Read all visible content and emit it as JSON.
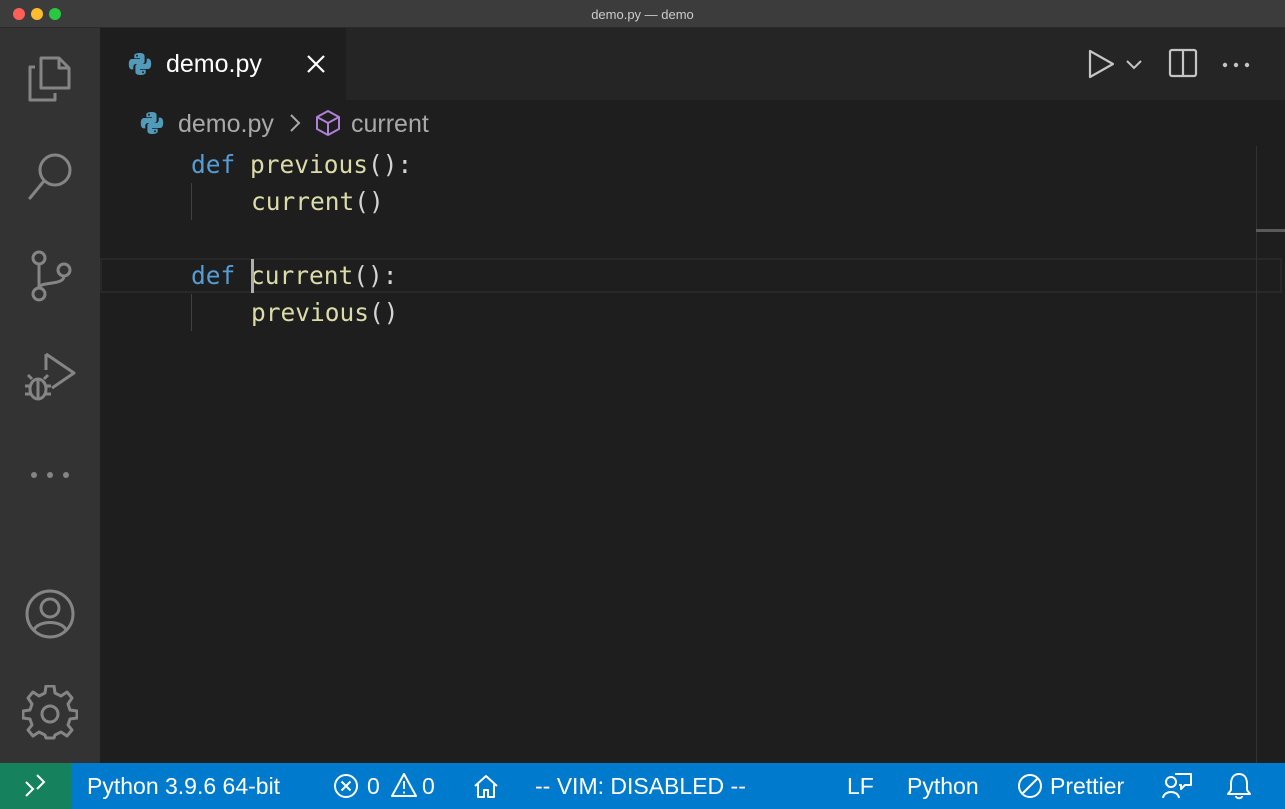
{
  "window": {
    "title": "demo.py — demo"
  },
  "activity_bar": {
    "items": [
      {
        "name": "explorer",
        "icon": "files-icon"
      },
      {
        "name": "search",
        "icon": "search-icon"
      },
      {
        "name": "source-control",
        "icon": "source-control-icon"
      },
      {
        "name": "run-debug",
        "icon": "run-debug-icon"
      },
      {
        "name": "more",
        "icon": "ellipsis-icon"
      }
    ],
    "bottom": [
      {
        "name": "accounts",
        "icon": "account-icon"
      },
      {
        "name": "manage",
        "icon": "gear-icon"
      }
    ]
  },
  "tabs": [
    {
      "label": "demo.py",
      "icon": "python-icon",
      "active": true
    }
  ],
  "editor_actions": [
    "run-icon",
    "chevron-down-icon",
    "split-editor-icon",
    "ellipsis-icon"
  ],
  "breadcrumb": {
    "file": "demo.py",
    "symbol": "current",
    "symbol_icon": "cube-icon"
  },
  "code": {
    "lines": [
      {
        "keyword": "def",
        "name": "previous",
        "rest": "():"
      },
      {
        "call": "current",
        "rest": "()"
      },
      {},
      {
        "keyword": "def",
        "name": "current",
        "rest": "():"
      },
      {
        "call": "previous",
        "rest": "()"
      }
    ],
    "cursor_line": 4
  },
  "colors": {
    "keyword": "#569cd6",
    "function": "#dcdcaa",
    "statusbar": "#007acc",
    "remote": "#16825d"
  },
  "status_bar": {
    "interpreter": "Python 3.9.6 64-bit",
    "errors": "0",
    "warnings": "0",
    "vim": "-- VIM: DISABLED --",
    "eol": "LF",
    "language": "Python",
    "formatter": "Prettier"
  }
}
